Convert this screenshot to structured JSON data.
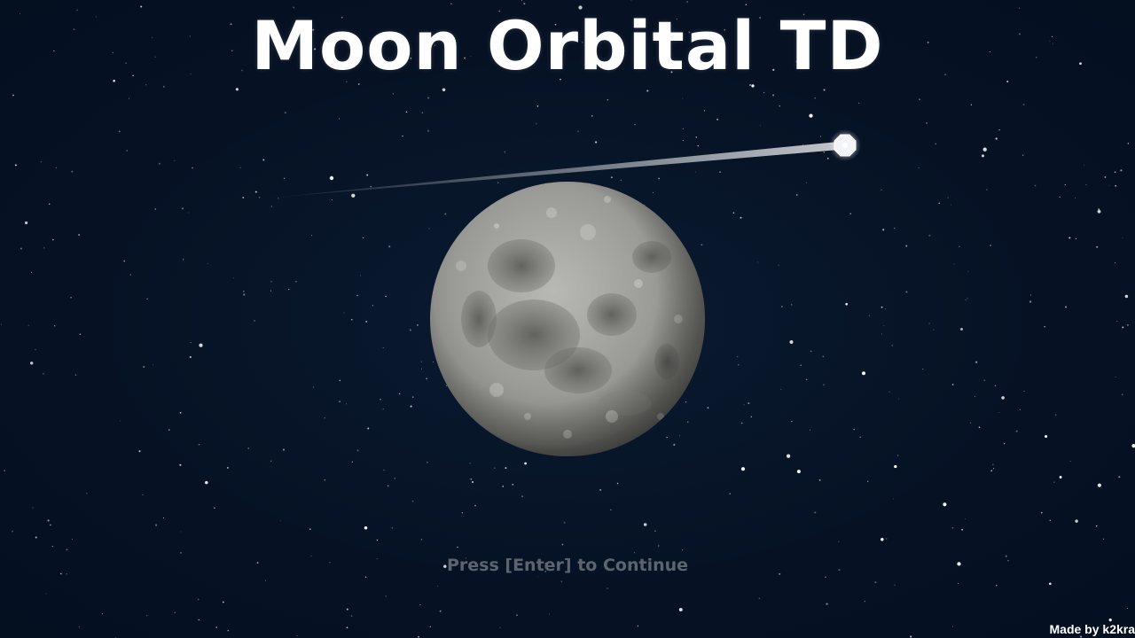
{
  "title": "Moon Orbital TD",
  "prompt": "Press [Enter] to Continue",
  "credit": "Made by k2kra",
  "icons": {
    "moon": "moon-icon",
    "satellite": "satellite-icon"
  },
  "colors": {
    "background": "#061224",
    "title": "#ffffff",
    "prompt": "#5c6470",
    "credit": "#ffffff"
  }
}
